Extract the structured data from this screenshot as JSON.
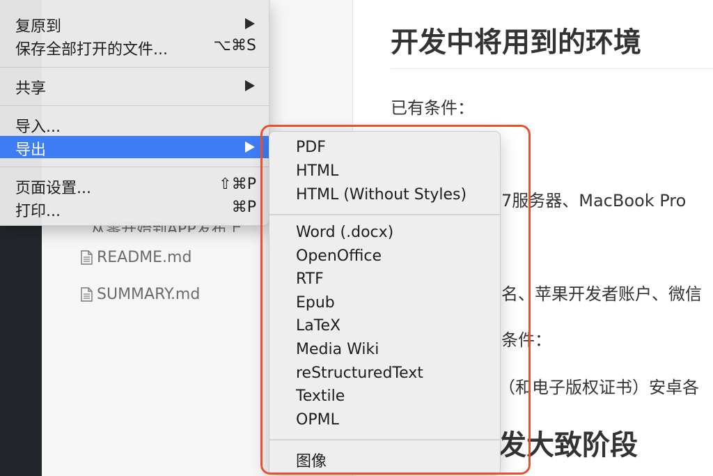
{
  "sidebar": {
    "files": [
      {
        "name": "README.md"
      },
      {
        "name": "SUMMARY.md"
      }
    ],
    "partial_file": "从零开始到APP发布上"
  },
  "editor": {
    "heading1": "开发中将用到的环境",
    "existing_conditions": "已有条件：",
    "line_server": "7服务器、MacBook Pro",
    "line_accounts": "名、苹果开发者账户、微信",
    "line_conditions": "条件：",
    "line_copyright": "（和电子版权证书）安卓各",
    "heading2": "发大致阶段"
  },
  "file_menu": {
    "items": [
      {
        "label": "复原到",
        "submenu": true
      },
      {
        "label": "保存全部打开的文件...",
        "shortcut": "⌥⌘S"
      },
      {
        "label": "共享",
        "submenu": true
      },
      {
        "label": "导入..."
      },
      {
        "label": "导出",
        "submenu": true,
        "active": true
      },
      {
        "label": "页面设置...",
        "shortcut": "⇧⌘P"
      },
      {
        "label": "打印...",
        "shortcut": "⌘P"
      }
    ]
  },
  "export_menu": {
    "items": [
      {
        "label": "PDF"
      },
      {
        "label": "HTML"
      },
      {
        "label": "HTML (Without Styles)"
      },
      {
        "label": "Word (.docx)"
      },
      {
        "label": "OpenOffice"
      },
      {
        "label": "RTF"
      },
      {
        "label": "Epub"
      },
      {
        "label": "LaTeX"
      },
      {
        "label": "Media Wiki"
      },
      {
        "label": "reStructuredText"
      },
      {
        "label": "Textile"
      },
      {
        "label": "OPML"
      },
      {
        "label": "图像"
      }
    ]
  },
  "colors": {
    "highlight_active": "#3d7df6",
    "annotation_border": "#e8502f"
  }
}
